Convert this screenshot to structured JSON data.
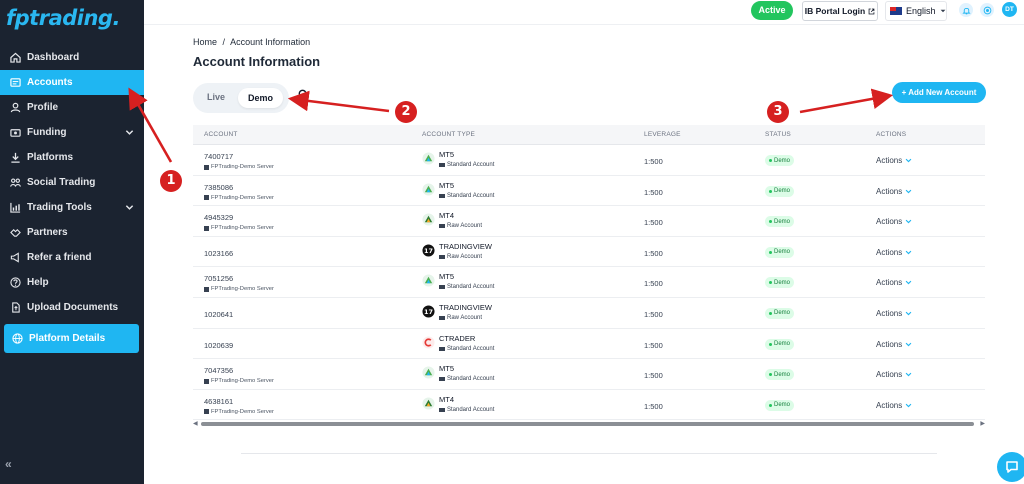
{
  "app": {
    "logo": "fptrading",
    "logo_dot": "."
  },
  "sidebar": {
    "items": [
      {
        "label": "Dashboard",
        "icon": "home-icon"
      },
      {
        "label": "Accounts",
        "icon": "accounts-icon",
        "active": true
      },
      {
        "label": "Profile",
        "icon": "profile-icon"
      },
      {
        "label": "Funding",
        "icon": "funding-icon",
        "expandable": true
      },
      {
        "label": "Platforms",
        "icon": "download-icon"
      },
      {
        "label": "Social Trading",
        "icon": "social-icon"
      },
      {
        "label": "Trading Tools",
        "icon": "chart-icon",
        "expandable": true
      },
      {
        "label": "Partners",
        "icon": "handshake-icon"
      },
      {
        "label": "Refer a friend",
        "icon": "megaphone-icon"
      },
      {
        "label": "Help",
        "icon": "help-icon"
      },
      {
        "label": "Upload Documents",
        "icon": "upload-icon"
      }
    ],
    "platform_details": "Platform Details",
    "collapse_label": "«"
  },
  "topbar": {
    "status": "Active",
    "ib_portal": "IB Portal Login",
    "language": "English",
    "avatar": "DT"
  },
  "breadcrumb": {
    "home": "Home",
    "separator": "/",
    "current": "Account Information"
  },
  "page_title": "Account Information",
  "toggle": {
    "live": "Live",
    "demo": "Demo",
    "selected": "Demo"
  },
  "add_account": "+ Add New Account",
  "table": {
    "headers": [
      "ACCOUNT",
      "ACCOUNT TYPE",
      "LEVERAGE",
      "STATUS",
      "ACTIONS"
    ],
    "rows": [
      {
        "account": "7400717",
        "server": "FPTrading-Demo Server",
        "platform": "MT5",
        "type": "Standard Account",
        "leverage": "1:500",
        "status": "Demo",
        "actions": "Actions"
      },
      {
        "account": "7385086",
        "server": "FPTrading-Demo Server",
        "platform": "MT5",
        "type": "Standard Account",
        "leverage": "1:500",
        "status": "Demo",
        "actions": "Actions"
      },
      {
        "account": "4945329",
        "server": "FPTrading-Demo Server",
        "platform": "MT4",
        "type": "Raw Account",
        "leverage": "1:500",
        "status": "Demo",
        "actions": "Actions"
      },
      {
        "account": "1023166",
        "server": "",
        "platform": "TRADINGVIEW",
        "type": "Raw Account",
        "leverage": "1:500",
        "status": "Demo",
        "actions": "Actions"
      },
      {
        "account": "7051256",
        "server": "FPTrading-Demo Server",
        "platform": "MT5",
        "type": "Standard Account",
        "leverage": "1:500",
        "status": "Demo",
        "actions": "Actions"
      },
      {
        "account": "1020641",
        "server": "",
        "platform": "TRADINGVIEW",
        "type": "Raw Account",
        "leverage": "1:500",
        "status": "Demo",
        "actions": "Actions"
      },
      {
        "account": "1020639",
        "server": "",
        "platform": "CTRADER",
        "type": "Standard Account",
        "leverage": "1:500",
        "status": "Demo",
        "actions": "Actions"
      },
      {
        "account": "7047356",
        "server": "FPTrading-Demo Server",
        "platform": "MT5",
        "type": "Standard Account",
        "leverage": "1:500",
        "status": "Demo",
        "actions": "Actions"
      },
      {
        "account": "4638161",
        "server": "FPTrading-Demo Server",
        "platform": "MT4",
        "type": "Standard Account",
        "leverage": "1:500",
        "status": "Demo",
        "actions": "Actions"
      }
    ]
  },
  "annotations": {
    "m1": "1",
    "m2": "2",
    "m3": "3"
  },
  "colors": {
    "accent": "#1fb6f2",
    "sidebar_bg": "#1b2330",
    "active_status": "#22c55e",
    "annotation": "#d62020"
  }
}
